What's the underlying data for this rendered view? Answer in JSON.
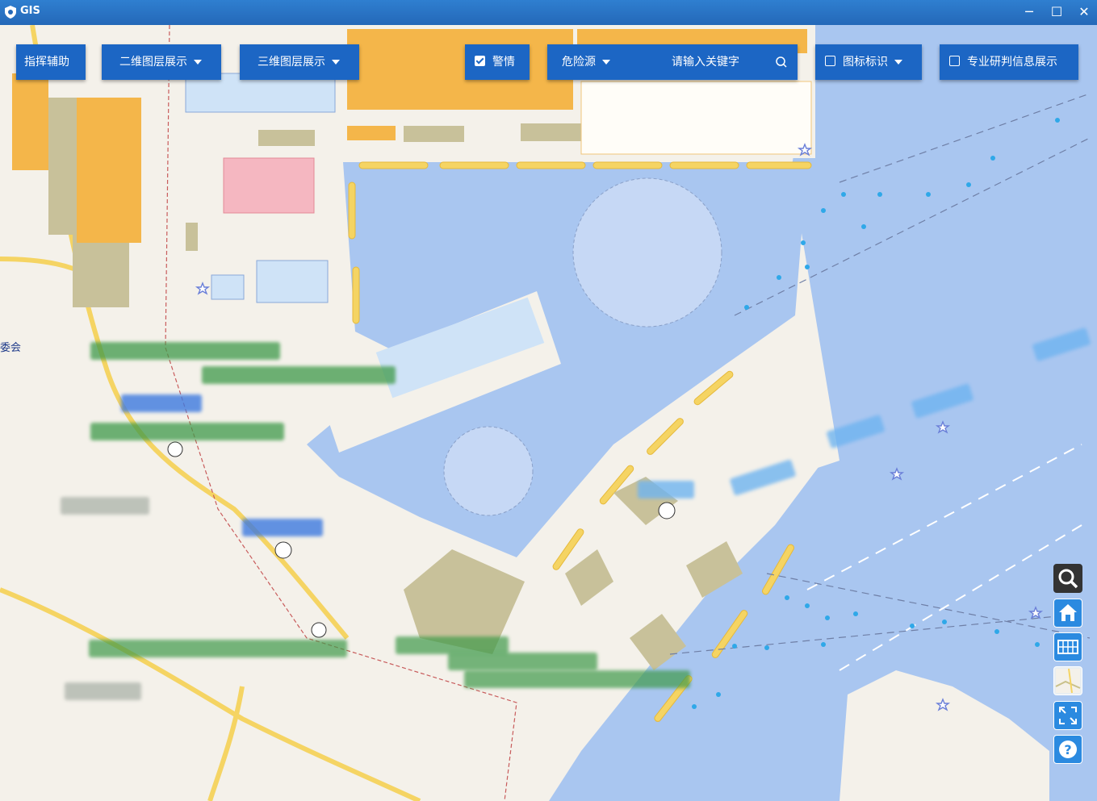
{
  "window": {
    "title": "GIS",
    "controls": {
      "minimize": "─",
      "maximize": "☐",
      "close": "✕"
    }
  },
  "toolbar": {
    "command_assist": "指挥辅助",
    "layer_2d": "二维图层展示",
    "layer_3d": "三维图层展示",
    "alert_label": "警情",
    "alert_checked": true,
    "hazard_label": "危险源",
    "search_placeholder": "请输入关键字",
    "icon_marker_label": "图标标识",
    "icon_marker_checked": false,
    "expert_info_label": "专业研判信息展示",
    "expert_info_checked": false
  },
  "map_labels": {
    "committee": "委会"
  },
  "side_tools": [
    {
      "name": "search-tool",
      "icon": "search-icon"
    },
    {
      "name": "home-tool",
      "icon": "home-icon"
    },
    {
      "name": "grid-tool",
      "icon": "grid-icon"
    },
    {
      "name": "basemap-tool",
      "icon": "map-thumbnail-icon"
    },
    {
      "name": "fullscreen-tool",
      "icon": "expand-icon"
    },
    {
      "name": "help-tool",
      "icon": "help-icon"
    }
  ],
  "colors": {
    "titlebar": "#2468b8",
    "toolbar": "#1c66c4",
    "water": "#a9c6f0",
    "land": "#f4f1ea",
    "roads": "#f5d463",
    "buildings": "#c8c19a",
    "markers": "#2fa8e8"
  }
}
